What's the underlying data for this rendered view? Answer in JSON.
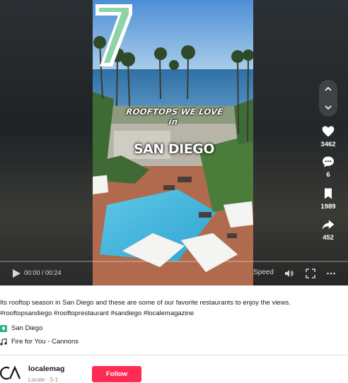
{
  "video": {
    "overlay_number": "7",
    "overlay_subtitle": "ROOFTOPS WE LOVE in",
    "overlay_city": "SAN DIEGO"
  },
  "actions": {
    "likes": "3462",
    "comments": "6",
    "saves": "1989",
    "shares": "452"
  },
  "controls": {
    "time": "00:00 / 00:24",
    "speed_label": "Speed",
    "progress_fraction": 0
  },
  "post": {
    "caption": "Its rooftop season in San Diego and these are some of our favorite restaurants to enjoy the views.",
    "hashtags": "#rooftopsandiego #rooftoprestaurant #sandiego #localemagazine",
    "location": "San Diego",
    "music": "Fire for You - Cannons"
  },
  "account": {
    "username": "localemag",
    "subtitle": "Locale · 5-1",
    "follow_label": "Follow"
  },
  "colors": {
    "accent": "#fe2c55",
    "location_icon": "#2ab27b",
    "seven_fill": "#8fd3a6"
  },
  "icons": [
    "chevron-up-icon",
    "chevron-down-icon",
    "heart-icon",
    "comment-icon",
    "bookmark-icon",
    "share-icon",
    "play-icon",
    "volume-icon",
    "fullscreen-icon",
    "more-icon",
    "location-icon",
    "music-note-icon"
  ]
}
